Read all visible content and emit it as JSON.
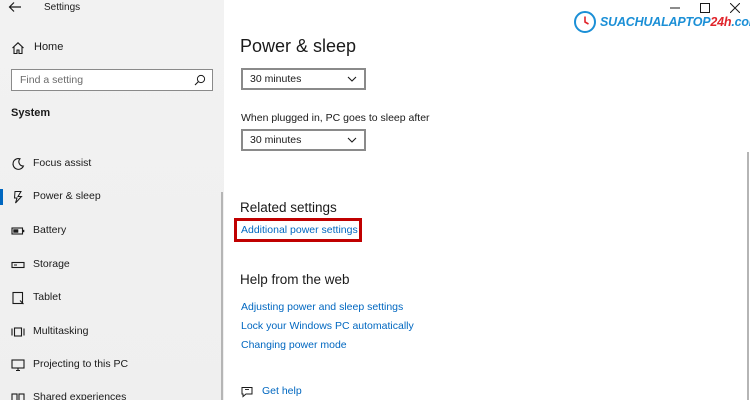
{
  "window": {
    "title": "Settings",
    "controls": {
      "minimize": "minimize-icon",
      "maximize": "maximize-icon",
      "close": "close-icon"
    }
  },
  "watermark": {
    "brand_main": "SUACHUALAPTOP",
    "brand_accent": "24h",
    "brand_suffix": ".com"
  },
  "sidebar": {
    "home_label": "Home",
    "search_placeholder": "Find a setting",
    "section_title": "System",
    "items": [
      {
        "label": "Focus assist",
        "icon": "moon-icon",
        "active": false
      },
      {
        "label": "Power & sleep",
        "icon": "power-icon",
        "active": true
      },
      {
        "label": "Battery",
        "icon": "battery-icon",
        "active": false
      },
      {
        "label": "Storage",
        "icon": "storage-icon",
        "active": false
      },
      {
        "label": "Tablet",
        "icon": "tablet-icon",
        "active": false
      },
      {
        "label": "Multitasking",
        "icon": "multitasking-icon",
        "active": false
      },
      {
        "label": "Projecting to this PC",
        "icon": "projecting-icon",
        "active": false
      },
      {
        "label": "Shared experiences",
        "icon": "shared-icon",
        "active": false
      }
    ]
  },
  "main": {
    "title": "Power & sleep",
    "screen_timeout_value": "30 minutes",
    "sleep_label": "When plugged in, PC goes to sleep after",
    "sleep_value": "30 minutes",
    "related_heading": "Related settings",
    "related_links": [
      "Additional power settings"
    ],
    "help_heading": "Help from the web",
    "help_links": [
      "Adjusting power and sleep settings",
      "Lock your Windows PC automatically",
      "Changing power mode"
    ],
    "get_help_label": "Get help"
  },
  "colors": {
    "accent": "#0067c0",
    "highlight": "#c00000",
    "sidebar_bg": "#f2f2f2"
  }
}
